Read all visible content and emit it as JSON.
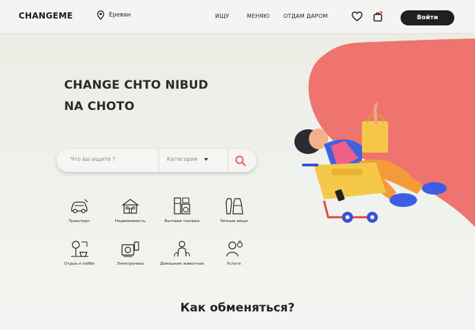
{
  "header": {
    "logo": "CHANGEME",
    "location": "Ереван",
    "nav": [
      "ИЩУ",
      "МЕНЯЮ",
      "ОТДАМ ДАРОМ"
    ],
    "login": "Войти",
    "icons": [
      "location-pin-icon",
      "heart-icon",
      "bag-icon"
    ]
  },
  "hero": {
    "headline_line1": "CHANGE CHTO NIBUD",
    "headline_line2": "NA CHOTO"
  },
  "search": {
    "placeholder": "Что вы ищите ?",
    "category": "Категория"
  },
  "categories": [
    {
      "label": "Транспорт",
      "icon": "car-icon"
    },
    {
      "label": "Недвижимость",
      "icon": "house-icon"
    },
    {
      "label": "Бытовая техника",
      "icon": "appliances-icon"
    },
    {
      "label": "Личные вещи",
      "icon": "clothes-icon"
    },
    {
      "label": "Отдых и хобби",
      "icon": "leisure-icon"
    },
    {
      "label": "Электроника",
      "icon": "electronics-icon"
    },
    {
      "label": "Домашние животные",
      "icon": "pets-icon"
    },
    {
      "label": "Услуги",
      "icon": "services-icon"
    }
  ],
  "section": {
    "title": "Как обменяться?"
  },
  "colors": {
    "accent": "#ef706c",
    "dark": "#1f2020",
    "basket": "#f2c53a",
    "wheel": "#3b4fd8"
  }
}
